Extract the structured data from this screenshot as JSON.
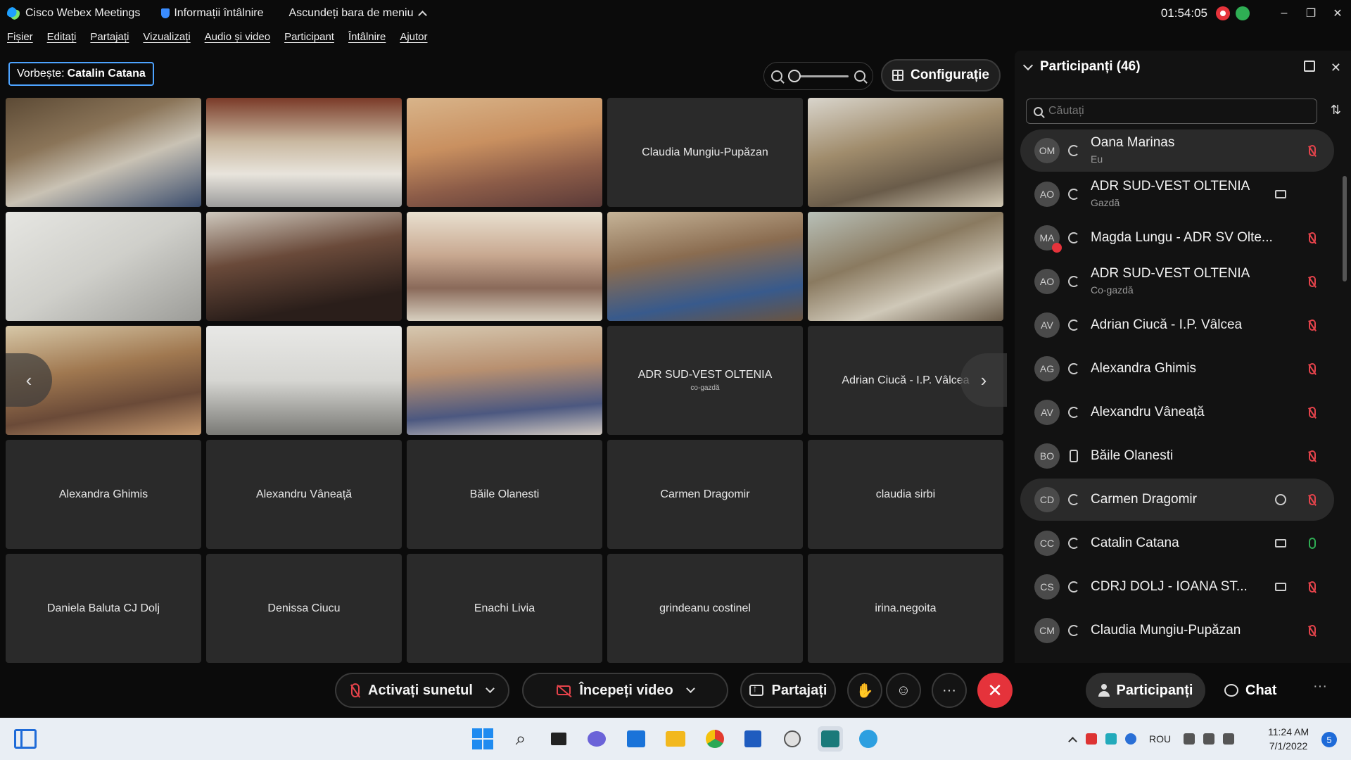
{
  "window": {
    "app_title": "Cisco Webex Meetings",
    "meeting_info": "Informații întâlnire",
    "hide_menu": "Ascundeți bara de meniu",
    "timer": "01:54:05",
    "minimize": "–",
    "restore": "❐",
    "close": "✕"
  },
  "menu": [
    "Fișier",
    "Editați",
    "Partajați",
    "Vizualizați",
    "Audio și video",
    "Participant",
    "Întâlnire",
    "Ajutor"
  ],
  "speaker": {
    "label": "Vorbește:",
    "name": "Catalin Catana"
  },
  "config_button": "Configurație",
  "tiles": [
    {
      "name": "",
      "sub": ""
    },
    {
      "name": "",
      "sub": ""
    },
    {
      "name": "",
      "sub": ""
    },
    {
      "name": "Claudia Mungiu-Pupăzan",
      "sub": ""
    },
    {
      "name": "",
      "sub": ""
    },
    {
      "name": "",
      "sub": ""
    },
    {
      "name": "",
      "sub": ""
    },
    {
      "name": "",
      "sub": ""
    },
    {
      "name": "",
      "sub": ""
    },
    {
      "name": "",
      "sub": ""
    },
    {
      "name": "",
      "sub": ""
    },
    {
      "name": "",
      "sub": ""
    },
    {
      "name": "",
      "sub": ""
    },
    {
      "name": "ADR SUD-VEST OLTENIA",
      "sub": "co-gazdă"
    },
    {
      "name": "Adrian Ciucă - I.P. Vâlcea",
      "sub": ""
    },
    {
      "name": "Alexandra Ghimis",
      "sub": ""
    },
    {
      "name": "Alexandru Vâneață",
      "sub": ""
    },
    {
      "name": "Băile Olanesti",
      "sub": ""
    },
    {
      "name": "Carmen Dragomir",
      "sub": ""
    },
    {
      "name": "claudia sirbi",
      "sub": ""
    },
    {
      "name": "Daniela Baluta CJ Dolj",
      "sub": ""
    },
    {
      "name": "Denissa Ciucu",
      "sub": ""
    },
    {
      "name": "Enachi Livia",
      "sub": ""
    },
    {
      "name": "grindeanu costinel",
      "sub": ""
    },
    {
      "name": "irina.negoita",
      "sub": ""
    }
  ],
  "panel": {
    "title": "Participanți (46)",
    "search_placeholder": "Căutați",
    "participants": [
      {
        "initials": "OM",
        "name": "Oana Marinas",
        "role": "Eu",
        "video": "",
        "mic": "muted"
      },
      {
        "initials": "AO",
        "name": "ADR SUD-VEST OLTENIA",
        "role": "Gazdă",
        "video": "camera",
        "mic": ""
      },
      {
        "initials": "MA",
        "name": "Magda Lungu - ADR SV Olte...",
        "role": "",
        "video": "",
        "mic": "muted"
      },
      {
        "initials": "AO",
        "name": "ADR SUD-VEST OLTENIA",
        "role": "Co-gazdă",
        "video": "",
        "mic": "muted"
      },
      {
        "initials": "AV",
        "name": "Adrian Ciucă - I.P. Vâlcea",
        "role": "",
        "video": "",
        "mic": "muted"
      },
      {
        "initials": "AG",
        "name": "Alexandra Ghimis",
        "role": "",
        "video": "",
        "mic": "muted"
      },
      {
        "initials": "AV",
        "name": "Alexandru Vâneață",
        "role": "",
        "video": "",
        "mic": "muted"
      },
      {
        "initials": "BO",
        "name": "Băile Olanesti",
        "role": "",
        "video": "",
        "mic": "muted"
      },
      {
        "initials": "CD",
        "name": "Carmen Dragomir",
        "role": "",
        "video": "chat",
        "mic": "muted"
      },
      {
        "initials": "CC",
        "name": "Catalin Catana",
        "role": "",
        "video": "camera",
        "mic": "on"
      },
      {
        "initials": "CS",
        "name": "CDRJ DOLJ - IOANA ST...",
        "role": "",
        "video": "camera",
        "mic": "muted"
      },
      {
        "initials": "CM",
        "name": "Claudia Mungiu-Pupăzan",
        "role": "",
        "video": "",
        "mic": "muted"
      }
    ]
  },
  "controls": {
    "unmute": "Activați sunetul",
    "start_video": "Începeți video",
    "share": "Partajați",
    "participants": "Participanți",
    "chat": "Chat",
    "more": "···",
    "end": "✕"
  },
  "taskbar": {
    "language": "ROU",
    "time": "11:24 AM",
    "date": "7/1/2022",
    "notifications": "5"
  },
  "colors": {
    "accent": "#4da3ff",
    "danger": "#e5333b",
    "active": "#2fae54"
  }
}
